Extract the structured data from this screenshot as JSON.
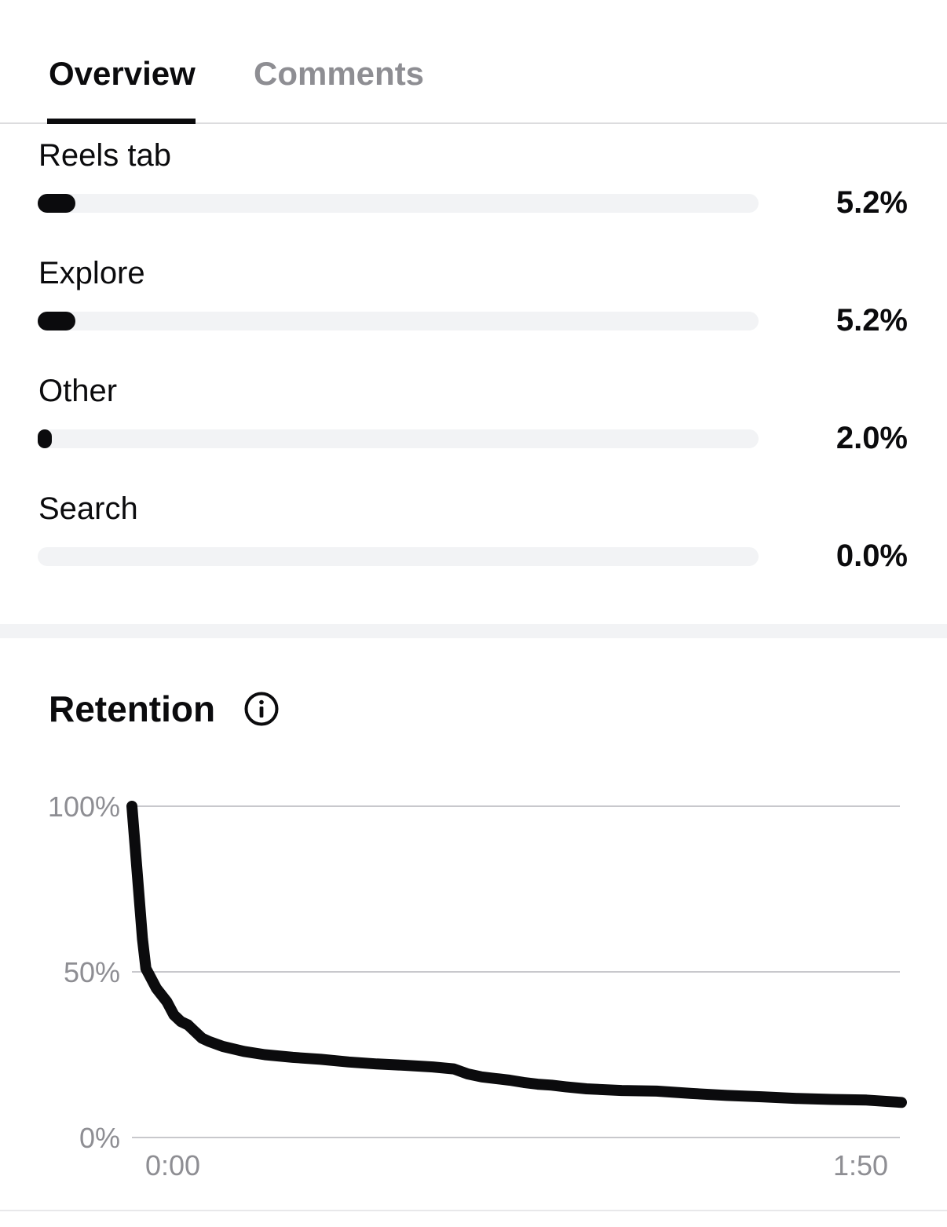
{
  "tabs": [
    {
      "label": "Overview",
      "active": true
    },
    {
      "label": "Comments",
      "active": false
    }
  ],
  "sources": [
    {
      "label": "Reels tab",
      "value_label": "5.2%",
      "fraction": 0.052
    },
    {
      "label": "Explore",
      "value_label": "5.2%",
      "fraction": 0.052
    },
    {
      "label": "Other",
      "value_label": "2.0%",
      "fraction": 0.02
    },
    {
      "label": "Search",
      "value_label": "0.0%",
      "fraction": 0.0
    }
  ],
  "retention": {
    "title": "Retention",
    "info_icon": "info-circle-icon"
  },
  "colors": {
    "text_primary": "#0b0b0d",
    "text_secondary": "#8e8e93",
    "track": "#f2f3f5",
    "gridline": "#c8c8cc"
  },
  "chart_data": {
    "type": "line",
    "title": "",
    "xlabel": "",
    "ylabel": "",
    "ylim": [
      0,
      100
    ],
    "y_ticks": [
      "100%",
      "50%",
      "0%"
    ],
    "y_tick_values": [
      100,
      50,
      0
    ],
    "x_ticks": [
      "0:00",
      "1:50"
    ],
    "x_tick_values": [
      0,
      110
    ],
    "x_unit": "seconds",
    "grid": true,
    "series": [
      {
        "x": [
          0,
          1.5,
          2,
          2.5,
          3.5,
          5,
          6,
          7,
          8,
          9,
          10,
          11,
          13,
          16,
          19,
          23,
          27,
          31,
          35,
          39,
          43,
          46,
          48,
          50,
          52,
          54,
          56,
          58,
          60,
          62,
          65,
          70,
          75,
          80,
          85,
          90,
          95,
          100,
          105,
          110
        ],
        "y": [
          100,
          60,
          51,
          49,
          45,
          41,
          37,
          35,
          34,
          32,
          30,
          29,
          27.5,
          26,
          25,
          24.2,
          23.6,
          22.8,
          22.2,
          21.8,
          21.3,
          20.7,
          19.2,
          18.3,
          17.8,
          17.3,
          16.6,
          16.1,
          15.8,
          15.3,
          14.7,
          14.2,
          14,
          13.3,
          12.7,
          12.3,
          11.8,
          11.5,
          11.3,
          10.6
        ]
      }
    ]
  }
}
